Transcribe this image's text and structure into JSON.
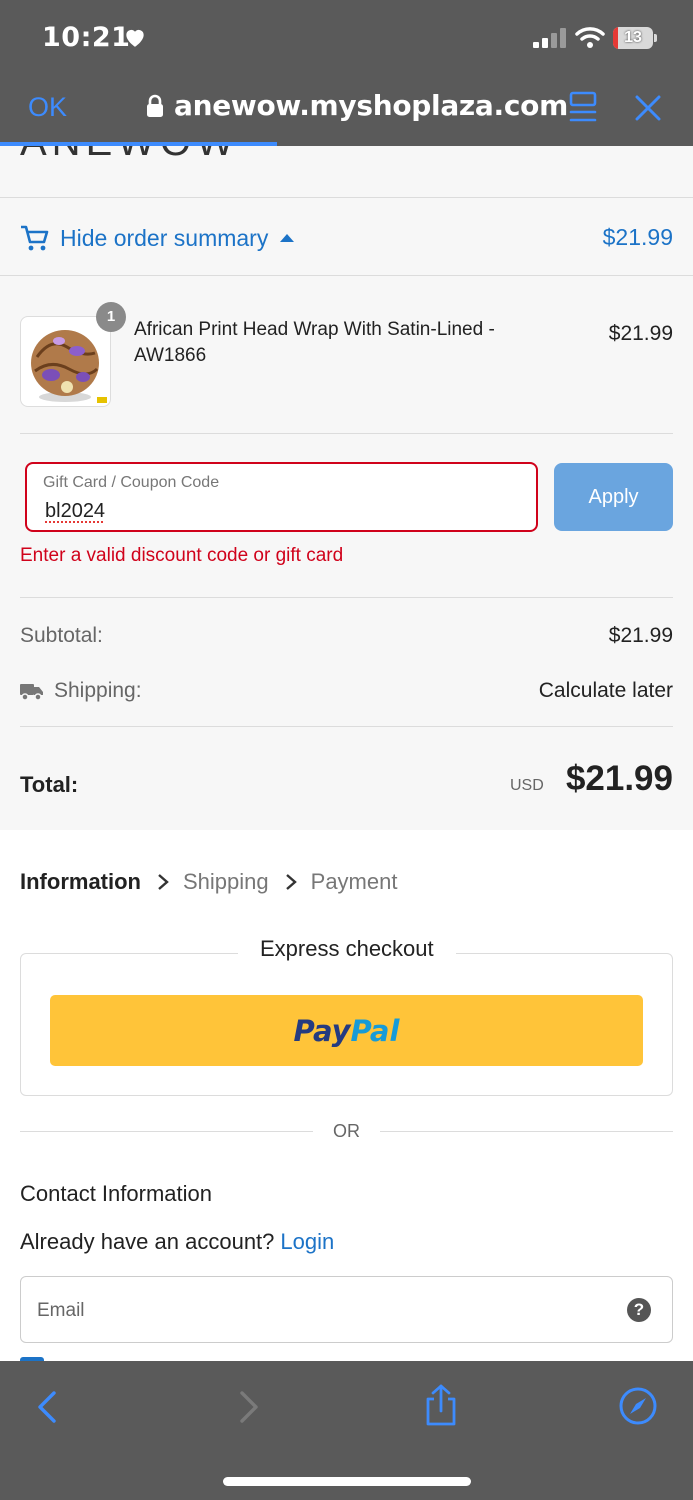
{
  "status_bar": {
    "time": "10:21",
    "battery_level": "13",
    "battery_percent": 13
  },
  "browser": {
    "done_label": "OK",
    "url": "anewow.myshoplaza.com",
    "accent_color": "#3d8bfd",
    "load_progress": 0.4
  },
  "store": {
    "logo_fragment": "ANEWOW"
  },
  "order_summary": {
    "toggle_label": "Hide order summary",
    "toggle_price": "$21.99",
    "item": {
      "quantity": "1",
      "name": "African Print Head Wrap With Satin-Lined - AW1866",
      "price": "$21.99"
    },
    "coupon": {
      "label": "Gift Card / Coupon Code",
      "value": "bl2024",
      "apply_label": "Apply",
      "error": "Enter a valid discount code or gift card",
      "error_color": "#d0021b"
    },
    "subtotal_label": "Subtotal:",
    "subtotal_value": "$21.99",
    "shipping_label": "Shipping:",
    "shipping_value": "Calculate later",
    "total_label": "Total:",
    "total_currency": "USD",
    "total_amount": "$21.99"
  },
  "checkout_steps": {
    "information": "Information",
    "shipping": "Shipping",
    "payment": "Payment"
  },
  "express_checkout": {
    "title": "Express checkout",
    "paypal_part1": "Pay",
    "paypal_part2": "Pal",
    "or_label": "OR"
  },
  "contact": {
    "title": "Contact Information",
    "account_prompt": "Already have an account?",
    "login_label": "Login",
    "email_placeholder": "Email",
    "help_symbol": "?"
  },
  "icons": {
    "heart": "heart-icon",
    "lock": "lock-icon",
    "reader": "reader-icon",
    "close": "close-icon",
    "cart": "cart-icon",
    "truck": "truck-icon",
    "back": "back-icon",
    "forward": "forward-icon",
    "share": "share-icon",
    "compass": "compass-icon"
  }
}
